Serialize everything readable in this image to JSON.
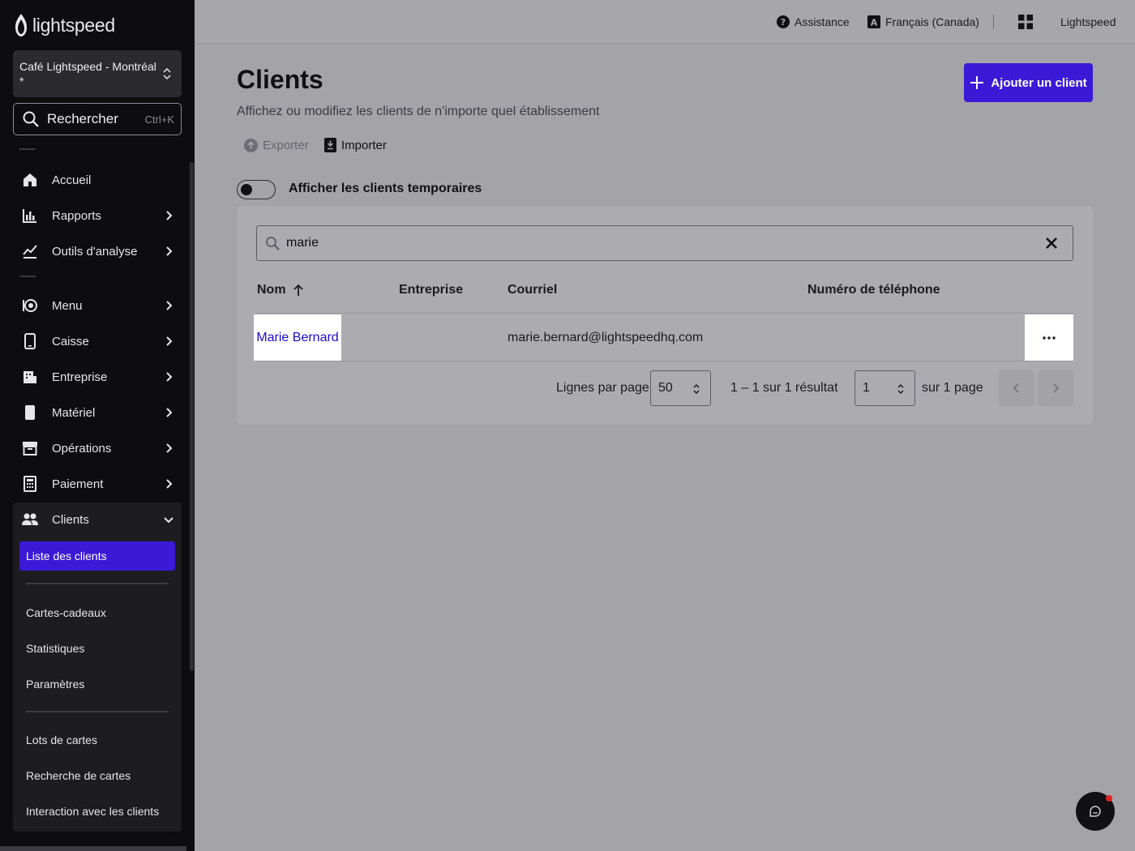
{
  "brand": {
    "logo_text": "lightspeed",
    "accent": "#3a1ad6"
  },
  "sidebar": {
    "store_name": "Café Lightspeed - Montréal *",
    "search": {
      "label": "Rechercher",
      "shortcut": "Ctrl+K"
    },
    "items": [
      {
        "label": "Accueil",
        "icon": "home-icon",
        "has_arrow": false
      },
      {
        "label": "Rapports",
        "icon": "bar-chart-icon",
        "has_arrow": true
      },
      {
        "label": "Outils d'analyse",
        "icon": "trend-chart-icon",
        "has_arrow": true
      },
      {
        "label": "Menu",
        "icon": "menu-dish-icon",
        "has_arrow": true
      },
      {
        "label": "Caisse",
        "icon": "tablet-icon",
        "has_arrow": true
      },
      {
        "label": "Entreprise",
        "icon": "building-icon",
        "has_arrow": true
      },
      {
        "label": "Matériel",
        "icon": "device-icon",
        "has_arrow": true
      },
      {
        "label": "Opérations",
        "icon": "archive-icon",
        "has_arrow": true
      },
      {
        "label": "Paiement",
        "icon": "calculator-icon",
        "has_arrow": true
      },
      {
        "label": "Clients",
        "icon": "users-icon",
        "expanded": true
      }
    ],
    "clients_submenu": {
      "active": "Liste des clients",
      "items": [
        "Cartes-cadeaux",
        "Statistiques",
        "Paramètres",
        "Lots de cartes",
        "Recherche de cartes",
        "Interaction avec les clients"
      ]
    }
  },
  "topbar": {
    "help": "Assistance",
    "language": "Français (Canada)",
    "account": "Lightspeed"
  },
  "main": {
    "title": "Clients",
    "subtitle": "Affichez ou modifiez les clients de n'importe quel établissement",
    "add_button": "Ajouter un client",
    "export_label": "Exporter",
    "import_label": "Importer",
    "toggle_label": "Afficher les clients temporaires",
    "toggle_on": false,
    "search_value": "marie",
    "table": {
      "columns": [
        "Nom",
        "Entreprise",
        "Courriel",
        "Numéro de téléphone"
      ],
      "sort": {
        "column": "Nom",
        "direction": "asc"
      },
      "rows": [
        {
          "name": "Marie Bernard",
          "company": "",
          "email": "marie.bernard@lightspeedhq.com",
          "phone": ""
        }
      ]
    },
    "pagination": {
      "rows_per_page_label": "Lignes par page",
      "rows_per_page": "50",
      "range_text": "1 – 1 sur 1 résultat",
      "page": "1",
      "pages_text": "sur 1 page"
    }
  }
}
